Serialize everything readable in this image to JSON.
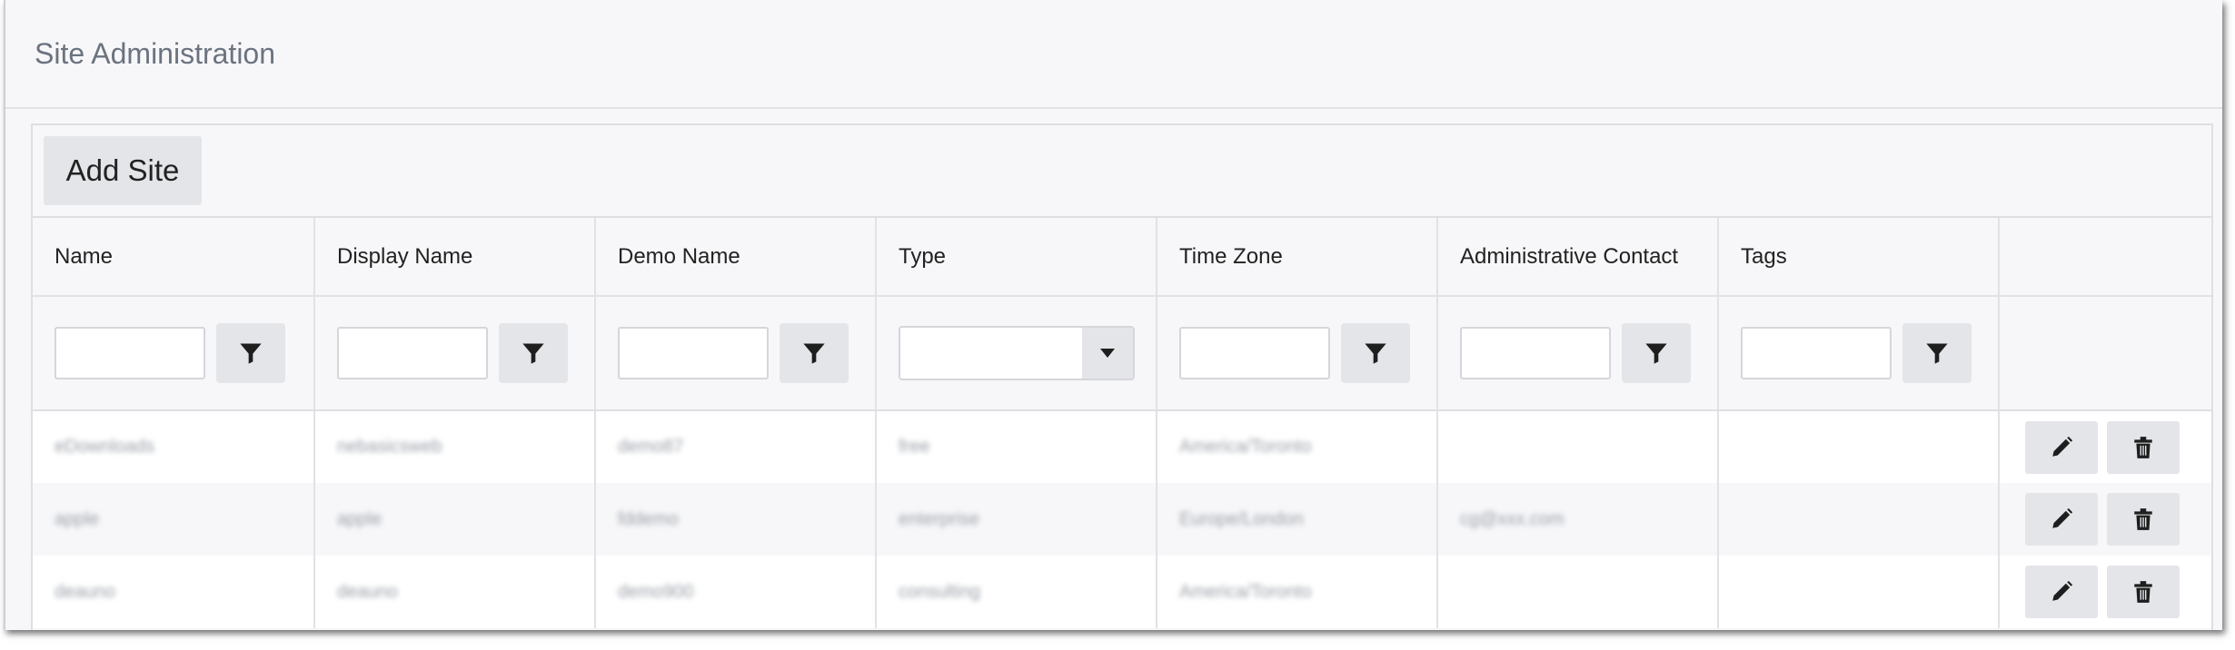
{
  "page": {
    "title": "Site Administration"
  },
  "toolbar": {
    "add_label": "Add Site"
  },
  "table": {
    "columns": [
      "Name",
      "Display Name",
      "Demo Name",
      "Type",
      "Time Zone",
      "Administrative Contact",
      "Tags",
      ""
    ],
    "rows": [
      [
        "eDownloads",
        "nebasicsweb",
        "demo87",
        "free",
        "America/Toronto",
        "",
        ""
      ],
      [
        "apple",
        "apple",
        "fddemo",
        "enterprise",
        "Europe/London",
        "cg@xxx.com",
        ""
      ],
      [
        "deauno",
        "deauno",
        "demo900",
        "consulting",
        "America/Toronto",
        "",
        ""
      ]
    ]
  },
  "icons": {
    "filter": "filter-funnel-icon",
    "edit": "pencil-icon",
    "delete": "trash-icon",
    "caret": "caret-down-icon"
  },
  "colors": {
    "background": "#f7f7f9",
    "button": "#e4e5e9",
    "border": "#dedfe3",
    "title": "#6b7380"
  }
}
